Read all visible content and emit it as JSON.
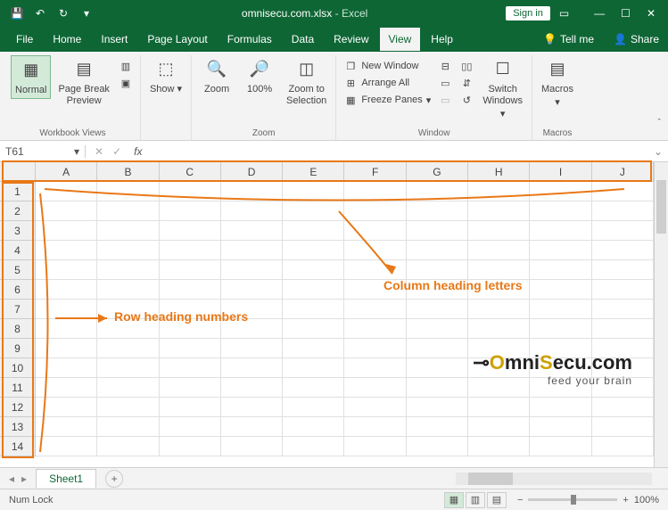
{
  "app": {
    "filename": "omnisecu.com.xlsx",
    "name": "Excel",
    "signin": "Sign in"
  },
  "tabs": [
    "File",
    "Home",
    "Insert",
    "Page Layout",
    "Formulas",
    "Data",
    "Review",
    "View",
    "Help"
  ],
  "active_tab": "View",
  "tellme": "Tell me",
  "share": "Share",
  "ribbon": {
    "workbook_views": {
      "label": "Workbook Views",
      "normal": "Normal",
      "page_break": "Page Break\nPreview"
    },
    "show": {
      "label": "Show",
      "btn": "Show"
    },
    "zoom_group": {
      "label": "Zoom",
      "zoom": "Zoom",
      "hundred": "100%",
      "to_sel": "Zoom to\nSelection"
    },
    "window": {
      "label": "Window",
      "new_win": "New Window",
      "arrange": "Arrange All",
      "freeze": "Freeze Panes",
      "switch": "Switch\nWindows"
    },
    "macros": {
      "label": "Macros",
      "btn": "Macros"
    }
  },
  "cellref": "T61",
  "fx": "fx",
  "grid": {
    "columns": [
      "A",
      "B",
      "C",
      "D",
      "E",
      "F",
      "G",
      "H",
      "I",
      "J"
    ],
    "rows": [
      "1",
      "2",
      "3",
      "4",
      "5",
      "6",
      "7",
      "8",
      "9",
      "10",
      "11",
      "12",
      "13",
      "14"
    ]
  },
  "annotations": {
    "col_label": "Column heading letters",
    "row_label": "Row heading numbers"
  },
  "watermark": {
    "brand_pre": "O",
    "brand_mid": "mni",
    "brand_suf": "Secu.com",
    "tag": "feed your brain",
    "key": "⊸"
  },
  "sheet": {
    "name": "Sheet1"
  },
  "status": {
    "numlock": "Num Lock",
    "zoom": "100%"
  },
  "colors": {
    "brand": "#0e6635",
    "accent": "#e87817"
  }
}
